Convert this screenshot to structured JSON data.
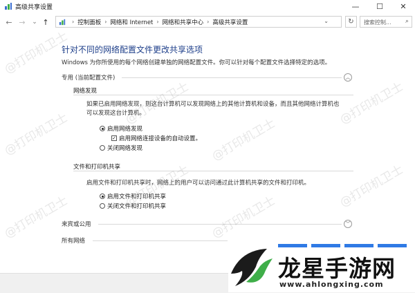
{
  "window": {
    "title": "高级共享设置",
    "minimize": "—",
    "maximize": "☐",
    "close": "✕"
  },
  "nav": {
    "back": "←",
    "forward": "→",
    "recent": "⌄",
    "up": "↑",
    "breadcrumbs": [
      "控制面板",
      "网络和 Internet",
      "网络和共享中心",
      "高级共享设置"
    ],
    "crumb_sep": "›",
    "dropdown": "⌄",
    "refresh": "↻",
    "search_placeholder": "搜索控制...",
    "search_icon": "⌕"
  },
  "content": {
    "title": "针对不同的网络配置文件更改共享选项",
    "description": "Windows 为你所使用的每个网络创建单独的网络配置文件。你可以针对每个配置文件选择特定的选项。",
    "private": {
      "header": "专用 (当前配置文件)",
      "collapse_icon": "︿",
      "discovery": {
        "title": "网络发现",
        "text_line1": "如果已启用网络发现，则这台计算机可以发现网络上的其他计算机和设备，而且其他网络计算机也",
        "text_line2": "可以发现这台计算机。",
        "on_label": "启用网络发现",
        "auto_label": "启用网络连接设备的自动设置。",
        "off_label": "关闭网络发现"
      },
      "sharing": {
        "title": "文件和打印机共享",
        "text": "启用文件和打印机共享时，网络上的用户可以访问通过此计算机共享的文件和打印机。",
        "on_label": "启用文件和打印机共享",
        "off_label": "关闭文件和打印机共享"
      }
    },
    "guest": {
      "header": "来宾或公用",
      "expand_icon": "﹀"
    },
    "all": {
      "header": "所有网络"
    }
  },
  "watermark": "@打印机卫士",
  "logo": {
    "text": "龙星手游网",
    "url": "www.ahlongxing.com"
  },
  "colors": {
    "title_blue": "#1e3f8a",
    "logo_blue": "#2f7ae5",
    "logo_green": "#3fae49"
  }
}
